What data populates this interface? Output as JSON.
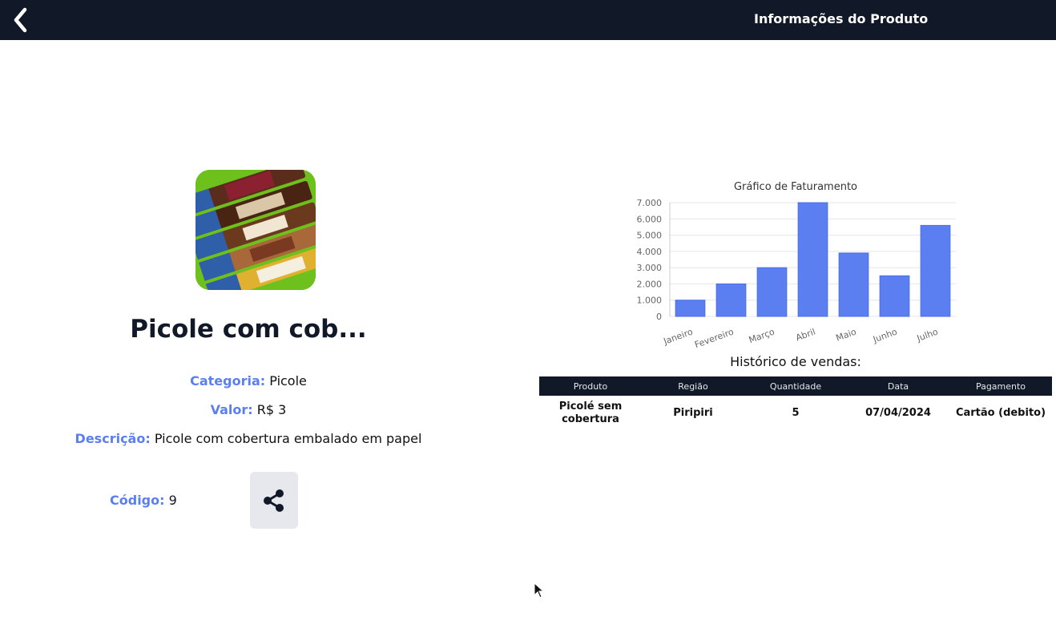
{
  "header": {
    "back_icon": "chevron-left-icon",
    "title": "Informações do Produto"
  },
  "product": {
    "name": "Picole com cob...",
    "image_alt": "Picolés Mabono",
    "category_label": "Categoria:",
    "category": "Picole",
    "value_label": "Valor:",
    "value": "R$ 3",
    "description_label": "Descrição:",
    "description": "Picole com cobertura embalado em papel",
    "code_label": "Código:",
    "code": "9",
    "share_icon": "share-icon"
  },
  "chart_data": {
    "type": "bar",
    "title": "Gráfico de Faturamento",
    "categories": [
      "Janeiro",
      "Fevereiro",
      "Março",
      "Abril",
      "Maio",
      "Junho",
      "Julho"
    ],
    "values": [
      1000,
      2000,
      3000,
      7000,
      3900,
      2500,
      5600
    ],
    "ylim": [
      0,
      7000
    ],
    "yticks": [
      "0",
      "1.000",
      "2.000",
      "3.000",
      "4.000",
      "5.000",
      "6.000",
      "7.000"
    ],
    "xlabel": "",
    "ylabel": "",
    "grid": true,
    "legend": "none",
    "bar_color": "#5b7ff0"
  },
  "history": {
    "title": "Histórico de vendas:",
    "columns": [
      "Produto",
      "Região",
      "Quantidade",
      "Data",
      "Pagamento"
    ],
    "rows": [
      [
        "Picolé sem cobertura",
        "Piripiri",
        "5",
        "07/04/2024",
        "Cartão (debito)"
      ]
    ]
  },
  "colors": {
    "header_bg": "#111827",
    "accent": "#5b7ff0"
  }
}
